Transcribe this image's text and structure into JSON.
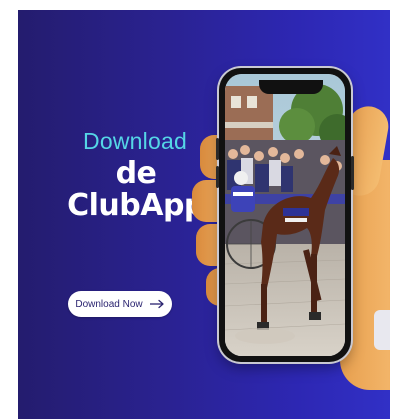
{
  "promo": {
    "headline_small": "Download",
    "headline_line1": "de",
    "headline_line2": "ClubApp",
    "cta_label": "Download Now"
  },
  "colors": {
    "background_left": "#241c6e",
    "background_right": "#3130c6",
    "accent_cyan": "#55d6e6",
    "button_bg": "#ffffff",
    "button_text": "#2b2470"
  },
  "icons": {
    "cta_arrow": "arrow-right-icon"
  },
  "image": {
    "subject": "harness-racing-horse-photo"
  }
}
